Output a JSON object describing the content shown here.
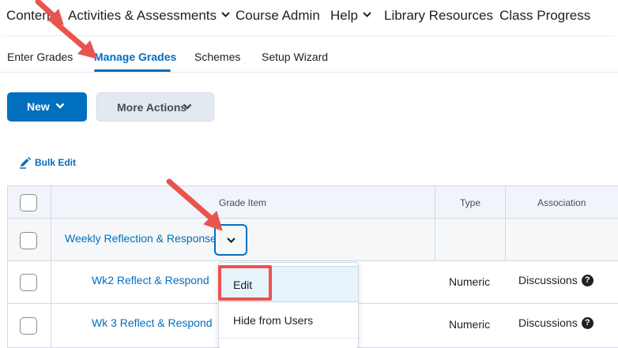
{
  "topnav": {
    "items": [
      "Content",
      "Activities & Assessments",
      "Course Admin",
      "Help",
      "Library Resources",
      "Class Progress"
    ]
  },
  "subnav": {
    "items": [
      "Enter Grades",
      "Manage Grades",
      "Schemes",
      "Setup Wizard"
    ],
    "active": "Manage Grades"
  },
  "toolbar": {
    "new_label": "New",
    "more_actions_label": "More Actions",
    "bulk_edit_label": "Bulk Edit"
  },
  "table": {
    "headers": {
      "grade_item": "Grade Item",
      "type": "Type",
      "association": "Association"
    },
    "group": {
      "name": "Weekly Reflection & Response"
    },
    "rows": [
      {
        "name": "Wk2 Reflect & Respond",
        "type": "Numeric",
        "association": "Discussions"
      },
      {
        "name": "Wk 3 Reflect & Respond",
        "type": "Numeric",
        "association": "Discussions"
      }
    ]
  },
  "context_menu": {
    "items": [
      "Edit",
      "Hide from Users"
    ],
    "highlighted": "Edit"
  },
  "colors": {
    "accent": "#006fbf",
    "annotation": "#e8554e"
  }
}
